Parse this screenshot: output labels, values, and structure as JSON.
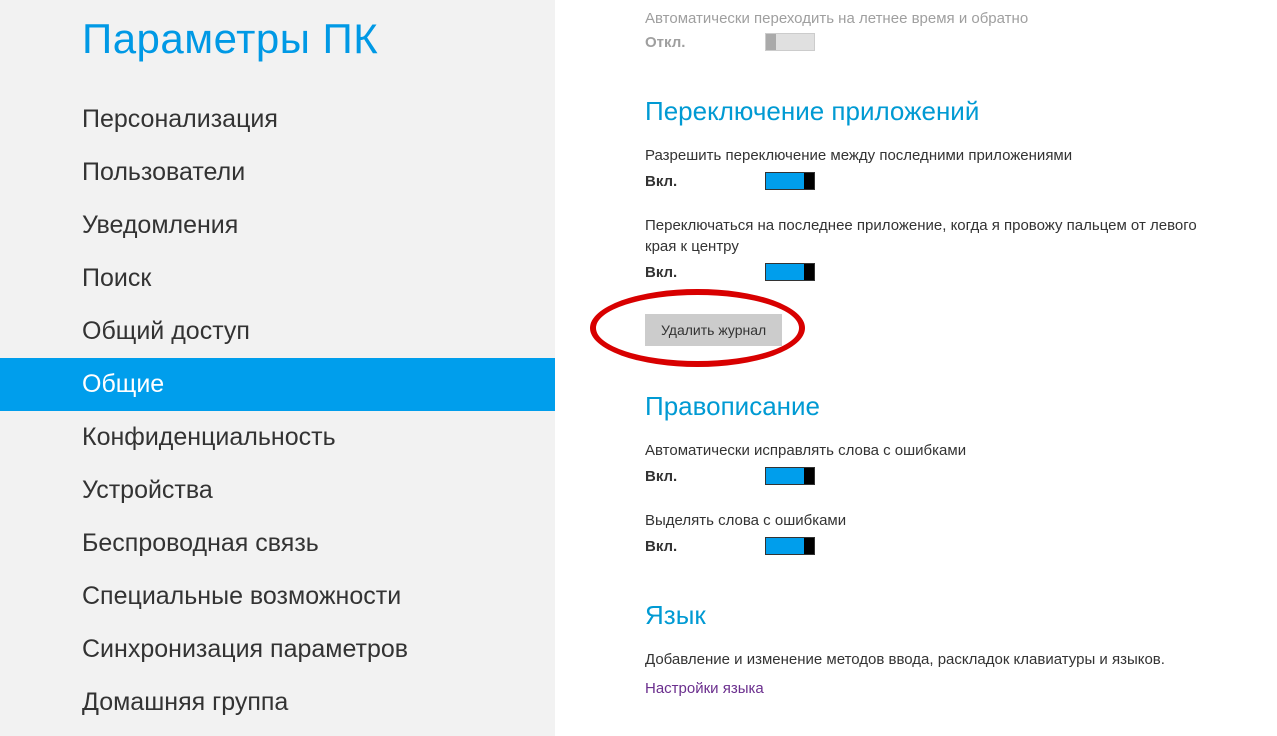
{
  "sidebar": {
    "title": "Параметры ПК",
    "items": [
      {
        "label": "Персонализация"
      },
      {
        "label": "Пользователи"
      },
      {
        "label": "Уведомления"
      },
      {
        "label": "Поиск"
      },
      {
        "label": "Общий доступ"
      },
      {
        "label": "Общие"
      },
      {
        "label": "Конфиденциальность"
      },
      {
        "label": "Устройства"
      },
      {
        "label": "Беспроводная связь"
      },
      {
        "label": "Специальные возможности"
      },
      {
        "label": "Синхронизация параметров"
      },
      {
        "label": "Домашняя группа"
      }
    ]
  },
  "content": {
    "dst": {
      "desc": "Автоматически переходить на летнее время и обратно",
      "state": "Откл."
    },
    "app_switching": {
      "heading": "Переключение приложений",
      "allow_switch": {
        "desc": "Разрешить переключение между последними приложениями",
        "state": "Вкл."
      },
      "edge_swipe": {
        "desc": "Переключаться на последнее приложение, когда я провожу пальцем от левого края к центру",
        "state": "Вкл."
      },
      "delete_button": "Удалить журнал"
    },
    "spelling": {
      "heading": "Правописание",
      "autocorrect": {
        "desc": "Автоматически исправлять слова с ошибками",
        "state": "Вкл."
      },
      "highlight": {
        "desc": "Выделять слова с ошибками",
        "state": "Вкл."
      }
    },
    "language": {
      "heading": "Язык",
      "desc": "Добавление и изменение методов ввода, раскладок клавиатуры и языков.",
      "link": "Настройки языка"
    }
  }
}
